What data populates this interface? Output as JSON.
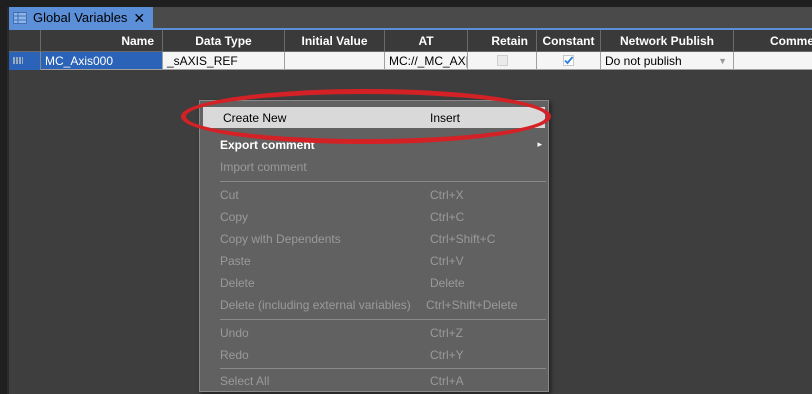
{
  "tab": {
    "title": "Global Variables",
    "close": "✕"
  },
  "columns": {
    "name": "Name",
    "data_type": "Data Type",
    "initial_value": "Initial Value",
    "at": "AT",
    "retain": "Retain",
    "constant": "Constant",
    "network_publish": "Network Publish",
    "comment": "Comment"
  },
  "row": {
    "name": "MC_Axis000",
    "data_type": "_sAXIS_REF",
    "initial_value": "",
    "at": "MC://_MC_AX|",
    "retain": false,
    "constant": true,
    "network_publish": "Do not publish",
    "comment": ""
  },
  "context_menu": {
    "create_new": {
      "label": "Create New",
      "shortcut": "Insert"
    },
    "export_comment": {
      "label": "Export comment",
      "arrow": "▸"
    },
    "import_comment": {
      "label": "Import comment"
    },
    "cut": {
      "label": "Cut",
      "shortcut": "Ctrl+X"
    },
    "copy": {
      "label": "Copy",
      "shortcut": "Ctrl+C"
    },
    "copy_with_dependents": {
      "label": "Copy with Dependents",
      "shortcut": "Ctrl+Shift+C"
    },
    "paste": {
      "label": "Paste",
      "shortcut": "Ctrl+V"
    },
    "delete": {
      "label": "Delete",
      "shortcut": "Delete"
    },
    "delete_external": {
      "label": "Delete (including external variables)",
      "shortcut": "Ctrl+Shift+Delete"
    },
    "undo": {
      "label": "Undo",
      "shortcut": "Ctrl+Z"
    },
    "redo": {
      "label": "Redo",
      "shortcut": "Ctrl+Y"
    },
    "select_all": {
      "label": "Select All",
      "shortcut": "Ctrl+A"
    }
  },
  "colors": {
    "highlight_oval": "#d42126",
    "tab_accent": "#5b8fd8",
    "selection": "#2b63b8"
  }
}
